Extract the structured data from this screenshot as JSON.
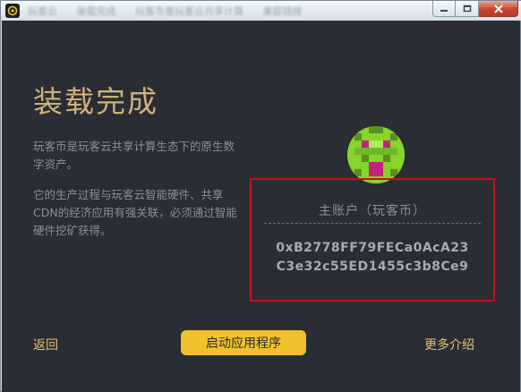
{
  "window": {
    "title_blurred": [
      "玩客云",
      "装载完成",
      "玩客币是玩客云共享计算",
      "兼容链接"
    ],
    "accent_color": "#cfb07a",
    "button_color": "#f0c12c",
    "highlight_color": "#c8101b"
  },
  "main": {
    "heading": "装载完成",
    "description_1": "玩客币是玩客云共享计算生态下的原生数字资产。",
    "description_2": "它的生产过程与玩客云智能硬件、共享CDN的经济应用有强关联，必须通过智能硬件挖矿获得。"
  },
  "account": {
    "label": "主账户（玩客币）",
    "address": "0xB2778FF79FECa0AcA23C3e32c55ED1455c3b8Ce9"
  },
  "actions": {
    "back": "返回",
    "launch": "启动应用程序",
    "more": "更多介绍"
  },
  "icons": {
    "app": "app-logo-icon",
    "minimize": "minimize-icon",
    "maximize": "maximize-icon",
    "close": "close-icon",
    "avatar": "pixel-avatar"
  }
}
